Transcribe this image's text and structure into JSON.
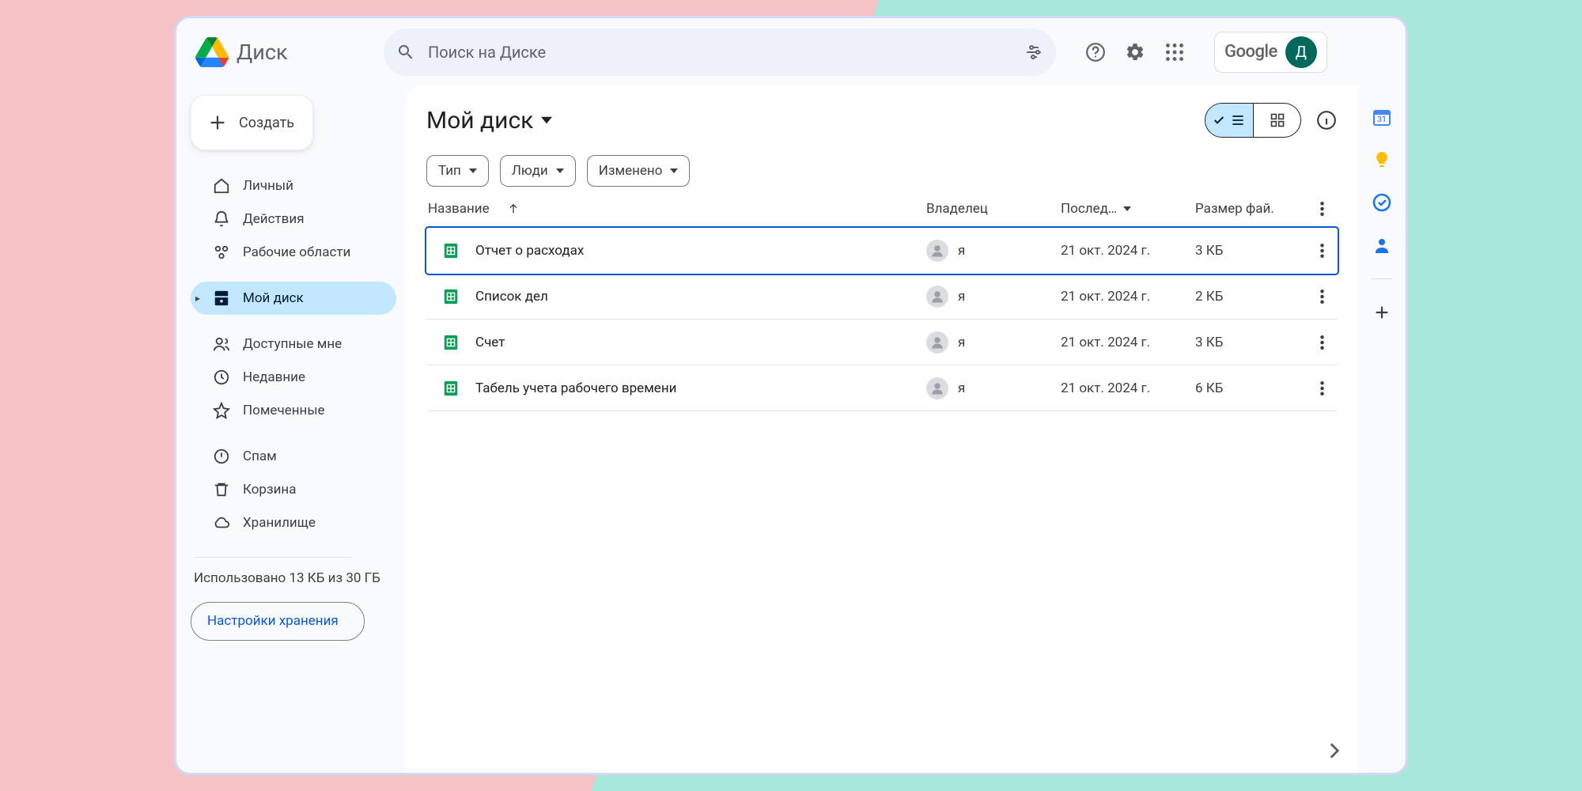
{
  "app": {
    "name": "Диск",
    "avatar_initial": "Д",
    "google_label": "Google"
  },
  "search": {
    "placeholder": "Поиск на Диске"
  },
  "create_label": "Создать",
  "nav": [
    {
      "label": "Личный"
    },
    {
      "label": "Действия"
    },
    {
      "label": "Рабочие области"
    }
  ],
  "nav2": [
    {
      "label": "Мой диск",
      "active": true,
      "expandable": true
    },
    {
      "label": "Доступные мне"
    },
    {
      "label": "Недавние"
    },
    {
      "label": "Помеченные"
    }
  ],
  "nav3": [
    {
      "label": "Спам"
    },
    {
      "label": "Корзина"
    },
    {
      "label": "Хранилище"
    }
  ],
  "storage": {
    "text": "Использовано 13 КБ из 30 ГБ",
    "settings_label": "Настройки хранения"
  },
  "page_title": "Мой диск",
  "chips": [
    {
      "label": "Тип"
    },
    {
      "label": "Люди"
    },
    {
      "label": "Изменено"
    }
  ],
  "columns": {
    "name": "Название",
    "owner": "Владелец",
    "modified": "Послед…",
    "size": "Размер фай."
  },
  "owner_me": "я",
  "files": [
    {
      "name": "Отчет о расходах",
      "modified": "21 окт. 2024 г.",
      "size": "3 КБ",
      "selected": true
    },
    {
      "name": "Список дел",
      "modified": "21 окт. 2024 г.",
      "size": "2 КБ"
    },
    {
      "name": "Счет",
      "modified": "21 окт. 2024 г.",
      "size": "3 КБ"
    },
    {
      "name": "Табель учета рабочего времени",
      "modified": "21 окт. 2024 г.",
      "size": "6 КБ"
    }
  ]
}
